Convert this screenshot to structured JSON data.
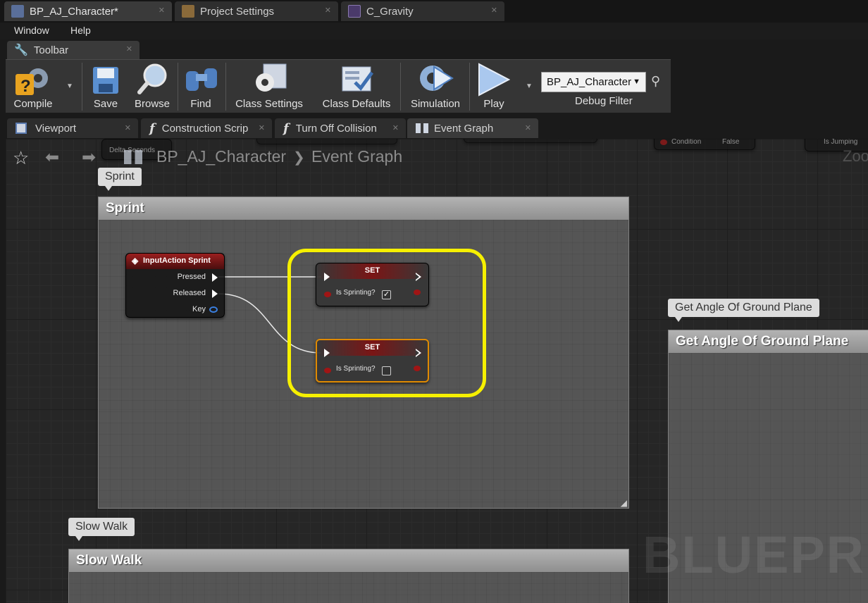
{
  "doc_tabs": [
    {
      "label": "BP_AJ_Character*",
      "icon": "blueprint-doc-icon"
    },
    {
      "label": "Project Settings",
      "icon": "settings-doc-icon"
    },
    {
      "label": "C_Gravity",
      "icon": "curve-doc-icon"
    }
  ],
  "menu": [
    "Window",
    "Help"
  ],
  "toolbar_tab": {
    "label": "Toolbar",
    "icon": "wrench-icon"
  },
  "toolbar": {
    "compile": "Compile",
    "save": "Save",
    "browse": "Browse",
    "find": "Find",
    "class_settings": "Class Settings",
    "class_defaults": "Class Defaults",
    "simulation": "Simulation",
    "play": "Play",
    "debug_object": "BP_AJ_Character",
    "debug_filter": "Debug Filter"
  },
  "editor_tabs": [
    {
      "label": "Viewport",
      "icon": "viewport-icon"
    },
    {
      "label": "Construction Scrip",
      "icon": "function-icon"
    },
    {
      "label": "Turn Off Collision",
      "icon": "function-icon"
    },
    {
      "label": "Event Graph",
      "icon": "graph-icon"
    }
  ],
  "breadcrumb": {
    "blueprint": "BP_AJ_Character",
    "separator": "❯",
    "graph": "Event Graph"
  },
  "background_nodes": {
    "delta_seconds": "Delta Seconds",
    "condition": "Condition",
    "false": "False",
    "is_jumping": "Is Jumping",
    "zoom": "Zoo"
  },
  "comments": {
    "sprint": {
      "bubble": "Sprint",
      "title": "Sprint"
    },
    "ground": {
      "bubble": "Get Angle Of Ground Plane",
      "title": "Get Angle Of Ground Plane"
    },
    "slow_walk": {
      "bubble": "Slow Walk",
      "title": "Slow Walk"
    }
  },
  "input_node": {
    "title": "InputAction Sprint",
    "pressed": "Pressed",
    "released": "Released",
    "key": "Key"
  },
  "set_nodes": [
    {
      "title": "SET",
      "var": "Is Sprinting?",
      "checked": true
    },
    {
      "title": "SET",
      "var": "Is Sprinting?",
      "checked": false
    }
  ],
  "watermark": "BLUEPRIN",
  "colors": {
    "highlight": "#f6f000",
    "node_header": "#9b1f1f",
    "selected_outline": "#e08a00"
  }
}
